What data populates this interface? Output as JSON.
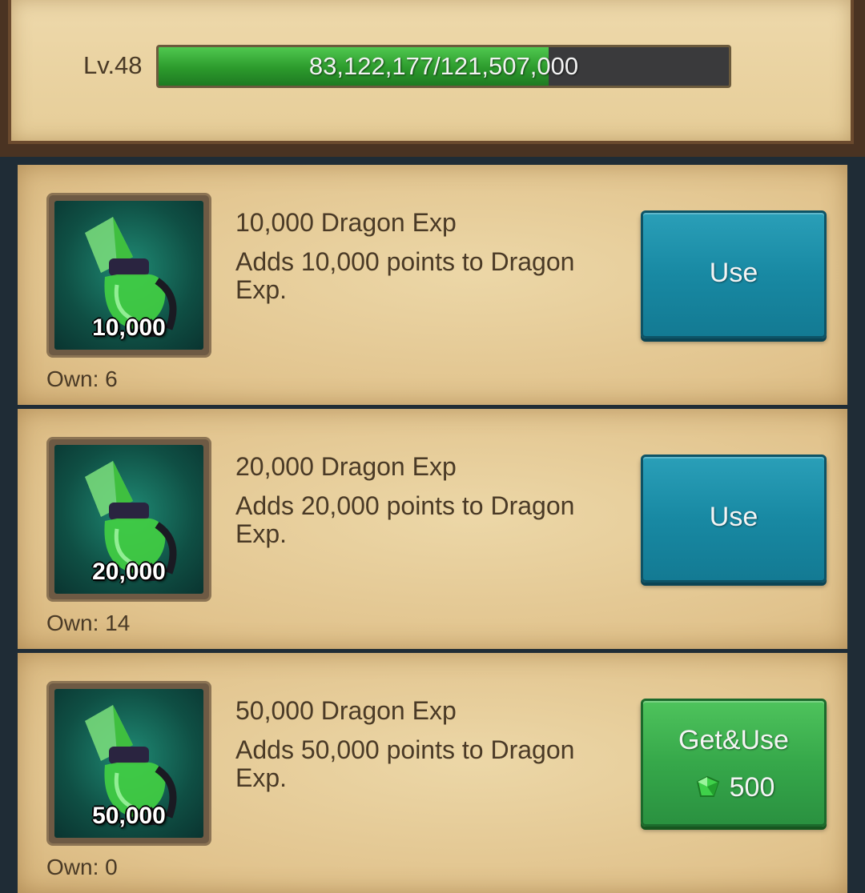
{
  "level": {
    "label": "Lv.48",
    "progress_text": "83,122,177/121,507,000",
    "progress_fraction": 0.684
  },
  "items": [
    {
      "amount": "10,000",
      "title": "10,000 Dragon Exp",
      "description": "Adds 10,000 points to Dragon Exp.",
      "own": "Own: 6",
      "button_label": "Use"
    },
    {
      "amount": "20,000",
      "title": "20,000 Dragon Exp",
      "description": "Adds 20,000 points to Dragon Exp.",
      "own": "Own: 14",
      "button_label": "Use"
    },
    {
      "amount": "50,000",
      "title": "50,000 Dragon Exp",
      "description": "Adds 50,000 points to Dragon Exp.",
      "own": "Own: 0",
      "button_label": "Get&Use",
      "cost": "500",
      "cost_icon": "gem-icon"
    }
  ],
  "colors": {
    "use_button": "#1889a3",
    "get_button": "#36a84a",
    "progress_fill": "#2c9a2c"
  }
}
